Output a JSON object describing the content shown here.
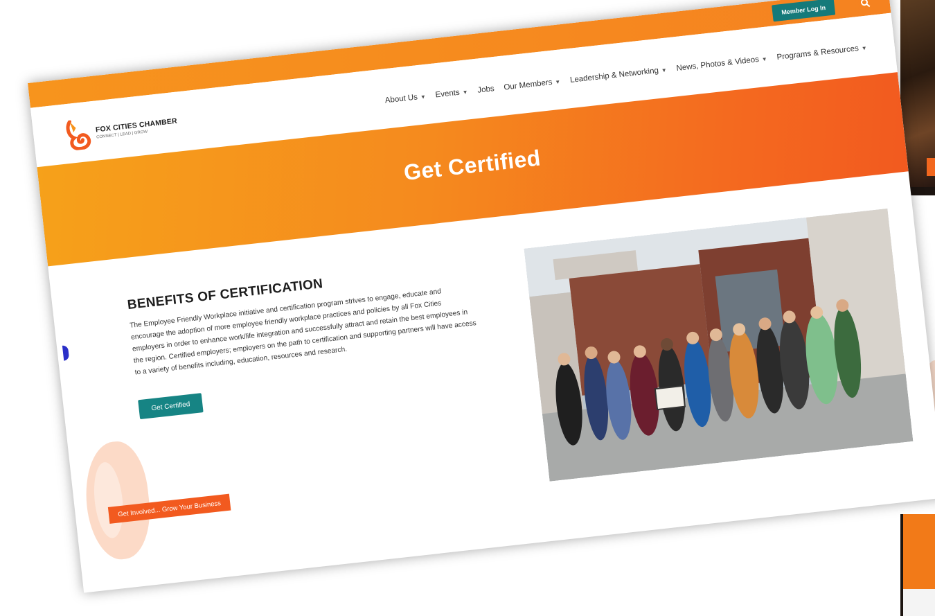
{
  "topbar": {
    "member_login_label": "Member Log In",
    "search_icon": "search-icon"
  },
  "brand": {
    "name": "FOX CITIES CHAMBER",
    "tagline": "CONNECT | LEAD | GROW"
  },
  "nav": {
    "items": [
      {
        "label": "About Us",
        "has_dropdown": true
      },
      {
        "label": "Events",
        "has_dropdown": true
      },
      {
        "label": "Jobs",
        "has_dropdown": false
      },
      {
        "label": "Our Members",
        "has_dropdown": true
      },
      {
        "label": "Leadership & Networking",
        "has_dropdown": true
      },
      {
        "label": "News, Photos & Videos",
        "has_dropdown": true
      },
      {
        "label": "Programs & Resources",
        "has_dropdown": true
      }
    ]
  },
  "hero": {
    "title": "Get Certified"
  },
  "main": {
    "benefits_title": "BENEFITS OF CERTIFICATION",
    "benefits_body": "The Employee Friendly Workplace initiative and certification program strives to engage, educate and encourage the adoption of more employee friendly workplace practices and policies by all Fox Cities employers in order to enhance work/life integration and successfully attract and retain the best employees in the region. Certified employers; employers on the path to certification and supporting partners will have access to a variety of benefits including, education, resources and research.",
    "cta_label": "Get Certified",
    "involve_label": "Get Involved... Grow Your Business"
  },
  "colors": {
    "accent_orange": "#f58220",
    "accent_teal": "#168484",
    "cta_orange": "#f25a1f"
  }
}
